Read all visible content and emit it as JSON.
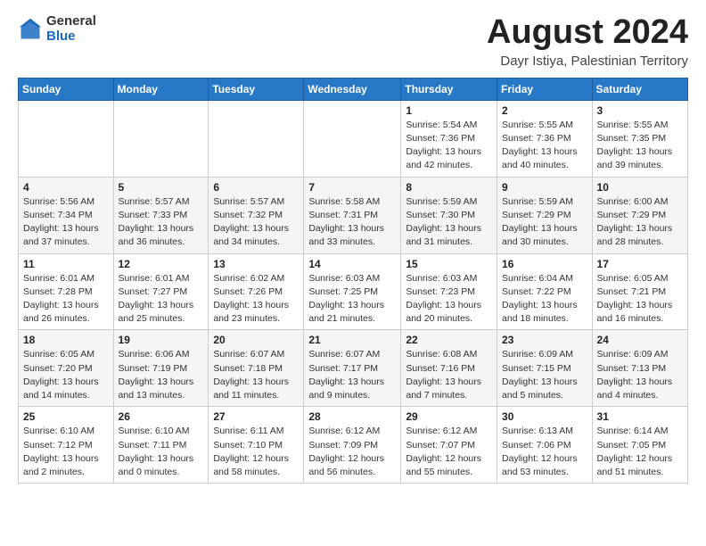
{
  "header": {
    "logo_general": "General",
    "logo_blue": "Blue",
    "main_title": "August 2024",
    "subtitle": "Dayr Istiya, Palestinian Territory"
  },
  "calendar": {
    "days_of_week": [
      "Sunday",
      "Monday",
      "Tuesday",
      "Wednesday",
      "Thursday",
      "Friday",
      "Saturday"
    ],
    "weeks": [
      [
        {
          "day": "",
          "info": ""
        },
        {
          "day": "",
          "info": ""
        },
        {
          "day": "",
          "info": ""
        },
        {
          "day": "",
          "info": ""
        },
        {
          "day": "1",
          "info": "Sunrise: 5:54 AM\nSunset: 7:36 PM\nDaylight: 13 hours\nand 42 minutes."
        },
        {
          "day": "2",
          "info": "Sunrise: 5:55 AM\nSunset: 7:36 PM\nDaylight: 13 hours\nand 40 minutes."
        },
        {
          "day": "3",
          "info": "Sunrise: 5:55 AM\nSunset: 7:35 PM\nDaylight: 13 hours\nand 39 minutes."
        }
      ],
      [
        {
          "day": "4",
          "info": "Sunrise: 5:56 AM\nSunset: 7:34 PM\nDaylight: 13 hours\nand 37 minutes."
        },
        {
          "day": "5",
          "info": "Sunrise: 5:57 AM\nSunset: 7:33 PM\nDaylight: 13 hours\nand 36 minutes."
        },
        {
          "day": "6",
          "info": "Sunrise: 5:57 AM\nSunset: 7:32 PM\nDaylight: 13 hours\nand 34 minutes."
        },
        {
          "day": "7",
          "info": "Sunrise: 5:58 AM\nSunset: 7:31 PM\nDaylight: 13 hours\nand 33 minutes."
        },
        {
          "day": "8",
          "info": "Sunrise: 5:59 AM\nSunset: 7:30 PM\nDaylight: 13 hours\nand 31 minutes."
        },
        {
          "day": "9",
          "info": "Sunrise: 5:59 AM\nSunset: 7:29 PM\nDaylight: 13 hours\nand 30 minutes."
        },
        {
          "day": "10",
          "info": "Sunrise: 6:00 AM\nSunset: 7:29 PM\nDaylight: 13 hours\nand 28 minutes."
        }
      ],
      [
        {
          "day": "11",
          "info": "Sunrise: 6:01 AM\nSunset: 7:28 PM\nDaylight: 13 hours\nand 26 minutes."
        },
        {
          "day": "12",
          "info": "Sunrise: 6:01 AM\nSunset: 7:27 PM\nDaylight: 13 hours\nand 25 minutes."
        },
        {
          "day": "13",
          "info": "Sunrise: 6:02 AM\nSunset: 7:26 PM\nDaylight: 13 hours\nand 23 minutes."
        },
        {
          "day": "14",
          "info": "Sunrise: 6:03 AM\nSunset: 7:25 PM\nDaylight: 13 hours\nand 21 minutes."
        },
        {
          "day": "15",
          "info": "Sunrise: 6:03 AM\nSunset: 7:23 PM\nDaylight: 13 hours\nand 20 minutes."
        },
        {
          "day": "16",
          "info": "Sunrise: 6:04 AM\nSunset: 7:22 PM\nDaylight: 13 hours\nand 18 minutes."
        },
        {
          "day": "17",
          "info": "Sunrise: 6:05 AM\nSunset: 7:21 PM\nDaylight: 13 hours\nand 16 minutes."
        }
      ],
      [
        {
          "day": "18",
          "info": "Sunrise: 6:05 AM\nSunset: 7:20 PM\nDaylight: 13 hours\nand 14 minutes."
        },
        {
          "day": "19",
          "info": "Sunrise: 6:06 AM\nSunset: 7:19 PM\nDaylight: 13 hours\nand 13 minutes."
        },
        {
          "day": "20",
          "info": "Sunrise: 6:07 AM\nSunset: 7:18 PM\nDaylight: 13 hours\nand 11 minutes."
        },
        {
          "day": "21",
          "info": "Sunrise: 6:07 AM\nSunset: 7:17 PM\nDaylight: 13 hours\nand 9 minutes."
        },
        {
          "day": "22",
          "info": "Sunrise: 6:08 AM\nSunset: 7:16 PM\nDaylight: 13 hours\nand 7 minutes."
        },
        {
          "day": "23",
          "info": "Sunrise: 6:09 AM\nSunset: 7:15 PM\nDaylight: 13 hours\nand 5 minutes."
        },
        {
          "day": "24",
          "info": "Sunrise: 6:09 AM\nSunset: 7:13 PM\nDaylight: 13 hours\nand 4 minutes."
        }
      ],
      [
        {
          "day": "25",
          "info": "Sunrise: 6:10 AM\nSunset: 7:12 PM\nDaylight: 13 hours\nand 2 minutes."
        },
        {
          "day": "26",
          "info": "Sunrise: 6:10 AM\nSunset: 7:11 PM\nDaylight: 13 hours\nand 0 minutes."
        },
        {
          "day": "27",
          "info": "Sunrise: 6:11 AM\nSunset: 7:10 PM\nDaylight: 12 hours\nand 58 minutes."
        },
        {
          "day": "28",
          "info": "Sunrise: 6:12 AM\nSunset: 7:09 PM\nDaylight: 12 hours\nand 56 minutes."
        },
        {
          "day": "29",
          "info": "Sunrise: 6:12 AM\nSunset: 7:07 PM\nDaylight: 12 hours\nand 55 minutes."
        },
        {
          "day": "30",
          "info": "Sunrise: 6:13 AM\nSunset: 7:06 PM\nDaylight: 12 hours\nand 53 minutes."
        },
        {
          "day": "31",
          "info": "Sunrise: 6:14 AM\nSunset: 7:05 PM\nDaylight: 12 hours\nand 51 minutes."
        }
      ]
    ]
  }
}
